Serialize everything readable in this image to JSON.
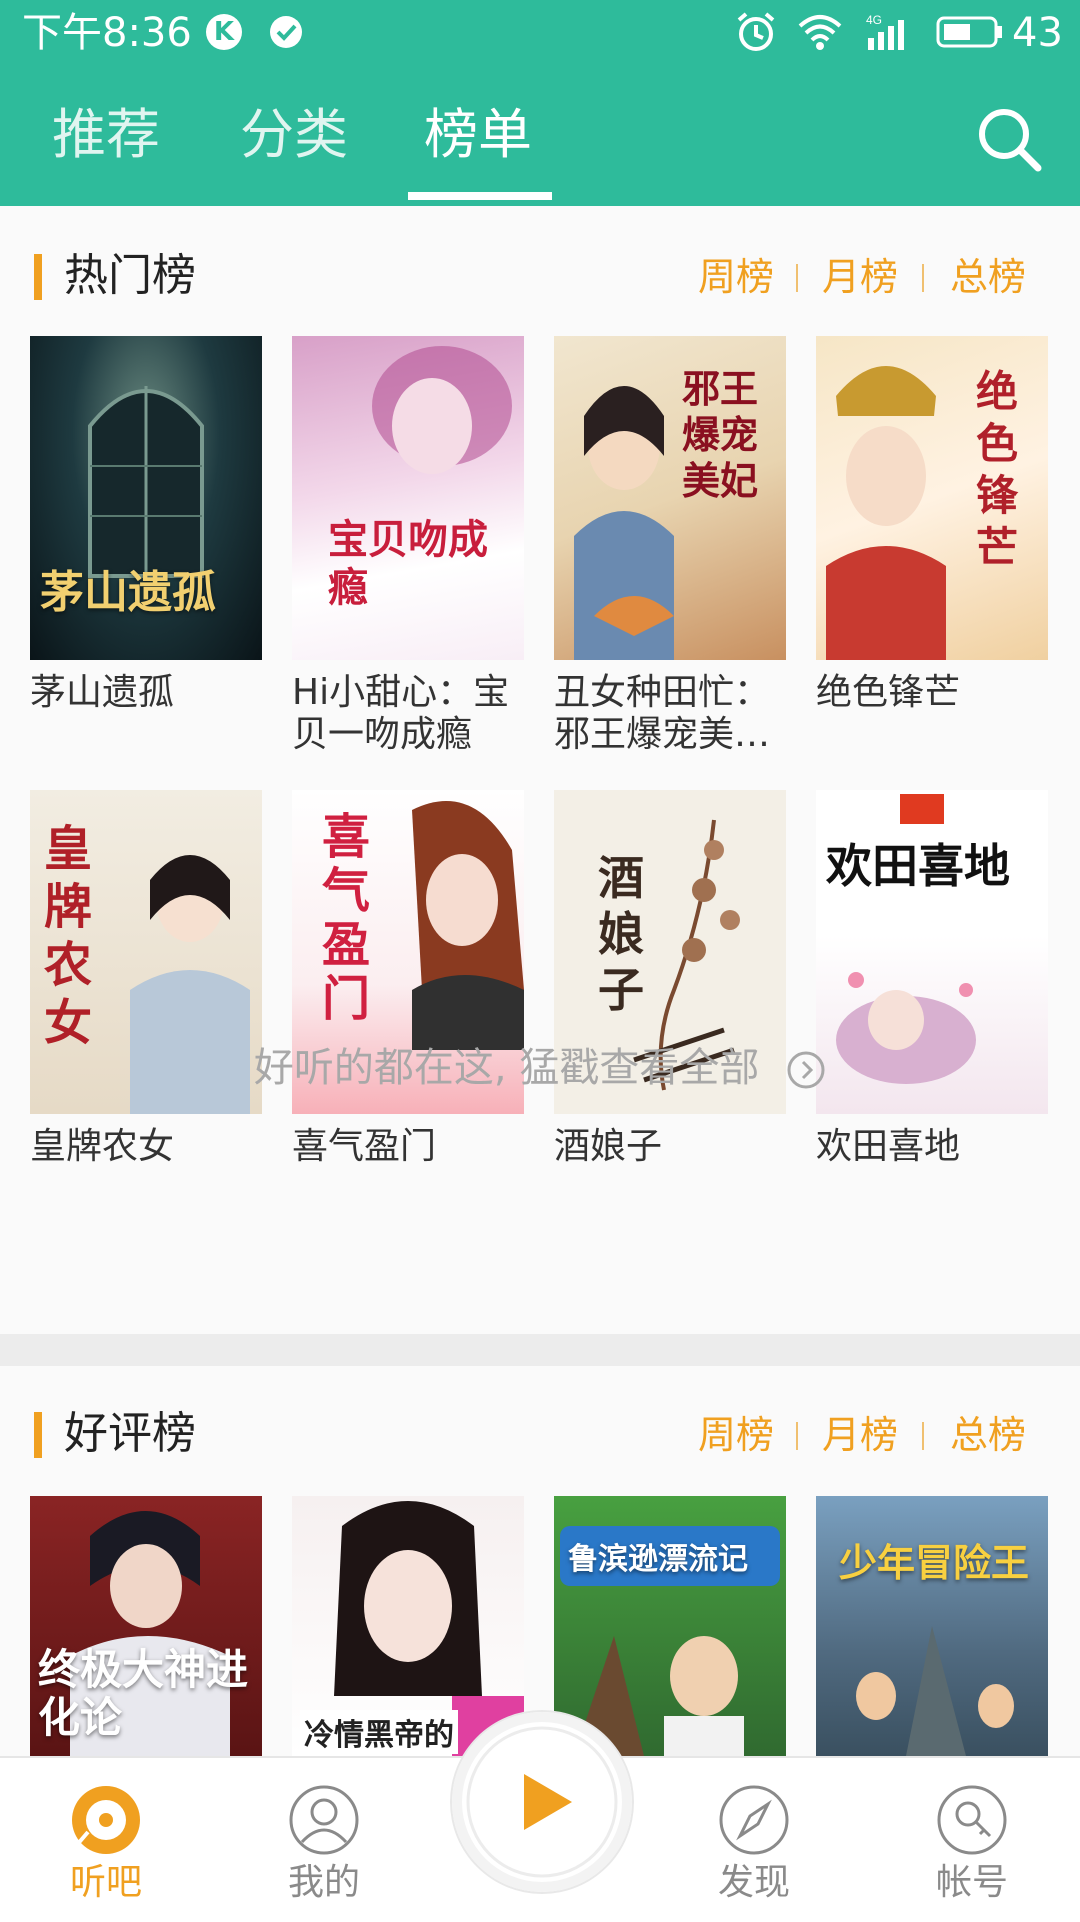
{
  "status_bar": {
    "time": "下午8:36",
    "k_icon": "K",
    "battery_level": "43",
    "network": "4G"
  },
  "nav": {
    "tabs": [
      {
        "label": "推荐"
      },
      {
        "label": "分类"
      },
      {
        "label": "榜单"
      }
    ],
    "active_tab": "榜单",
    "search_icon": "search-icon"
  },
  "sections": {
    "hot": {
      "title": "热门榜",
      "rank_links": [
        "周榜",
        "月榜",
        "总榜"
      ],
      "books": [
        {
          "name": "茅山遗孤",
          "cover_text": "茅山遗孤"
        },
        {
          "name": "Hi小甜心：宝贝一吻成瘾",
          "cover_text": "宝贝吻成瘾"
        },
        {
          "name": "丑女种田忙：邪王爆宠美…",
          "cover_text": "邪王爆宠美妃"
        },
        {
          "name": "绝色锋芒",
          "cover_text": "绝色锋芒"
        },
        {
          "name": "皇牌农女",
          "cover_text": "皇牌农女"
        },
        {
          "name": "喜气盈门",
          "cover_text": "喜气盈门"
        },
        {
          "name": "酒娘子",
          "cover_text": "酒娘子"
        },
        {
          "name": "欢田喜地",
          "cover_text": "欢田喜地"
        }
      ],
      "see_all": "好听的都在这, 猛戳查看全部"
    },
    "good": {
      "title": "好评榜",
      "rank_links": [
        "周榜",
        "月榜",
        "总榜"
      ],
      "books": [
        {
          "cover_text": "终极大神进化论"
        },
        {
          "cover_text": "冷情黑帝的"
        },
        {
          "cover_text": "鲁滨逊漂流记"
        },
        {
          "cover_text": "少年冒险王"
        }
      ]
    }
  },
  "bottom_bar": {
    "items": [
      {
        "label": "听吧",
        "icon": "disc-icon"
      },
      {
        "label": "我的",
        "icon": "user-icon"
      },
      {
        "label": "发现",
        "icon": "compass-icon"
      },
      {
        "label": "帐号",
        "icon": "key-icon"
      }
    ],
    "play_icon": "play-icon"
  },
  "colors": {
    "header": "#2ebb9b",
    "accent": "#f0a020",
    "text": "#333333"
  }
}
